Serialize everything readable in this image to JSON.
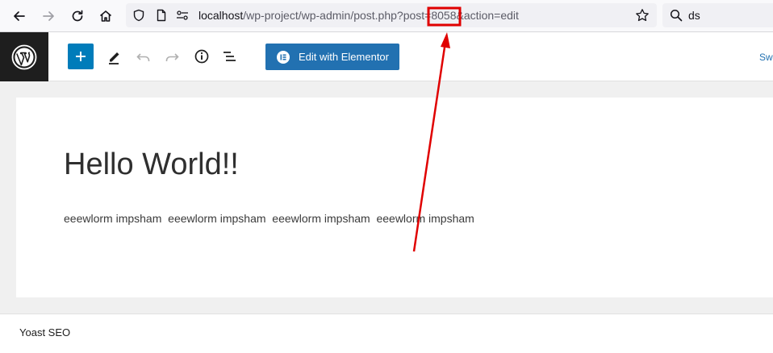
{
  "browser": {
    "url_host": "localhost",
    "url_path": "/wp-project/wp-admin/post.php?post=8058&action=edit",
    "search_value": "ds",
    "icons": {
      "back": "arrow-left-icon",
      "forward": "arrow-right-icon",
      "reload": "reload-icon",
      "home": "home-icon",
      "shield": "shield-icon",
      "page": "page-icon",
      "permissions": "permissions-icon",
      "bookmark": "star-icon",
      "search": "search-icon"
    }
  },
  "editor": {
    "toolbar": {
      "elementor_label": "Edit with Elementor",
      "switch_label": "Sw"
    },
    "post": {
      "title": "Hello World!!",
      "paragraph": "eeewlorm impsham  eeewlorm impsham  eeewlorm impsham  eeewlorm impsham"
    }
  },
  "metabox": {
    "yoast_label": "Yoast SEO"
  },
  "colors": {
    "accent": "#007cba",
    "elementor_button": "#2271b1",
    "annotation": "#e00000"
  }
}
